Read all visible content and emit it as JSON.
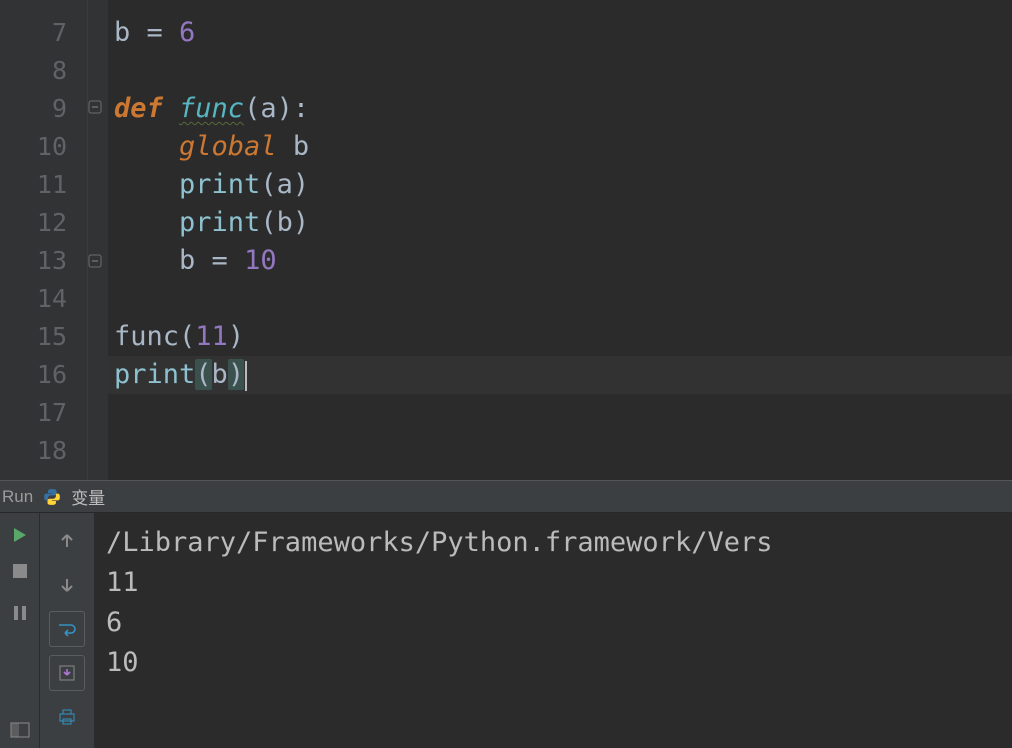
{
  "editor": {
    "line_numbers": [
      "7",
      "8",
      "9",
      "10",
      "11",
      "12",
      "13",
      "14",
      "15",
      "16",
      "17",
      "18"
    ],
    "code": {
      "l7": {
        "ident": "b",
        "op": " = ",
        "num": "6"
      },
      "l9": {
        "kw": "def ",
        "fn": "func",
        "open": "(",
        "param": "a",
        "close": ")",
        "colon": ":"
      },
      "l10": {
        "indent": "    ",
        "kw": "global",
        "sp": " ",
        "ident": "b"
      },
      "l11": {
        "indent": "    ",
        "fn": "print",
        "open": "(",
        "arg": "a",
        "close": ")"
      },
      "l12": {
        "indent": "    ",
        "fn": "print",
        "open": "(",
        "arg": "b",
        "close": ")"
      },
      "l13": {
        "indent": "    ",
        "ident": "b",
        "op": " = ",
        "num": "10"
      },
      "l15": {
        "fn": "func",
        "open": "(",
        "num": "11",
        "close": ")"
      },
      "l16": {
        "fn": "print",
        "open": "(",
        "arg": "b",
        "close": ")"
      }
    }
  },
  "run": {
    "tab_label": "Run",
    "vars_label": "变量",
    "console": {
      "path": "/Library/Frameworks/Python.framework/Vers",
      "out1": "11",
      "out2": "6",
      "out3": "10"
    }
  }
}
